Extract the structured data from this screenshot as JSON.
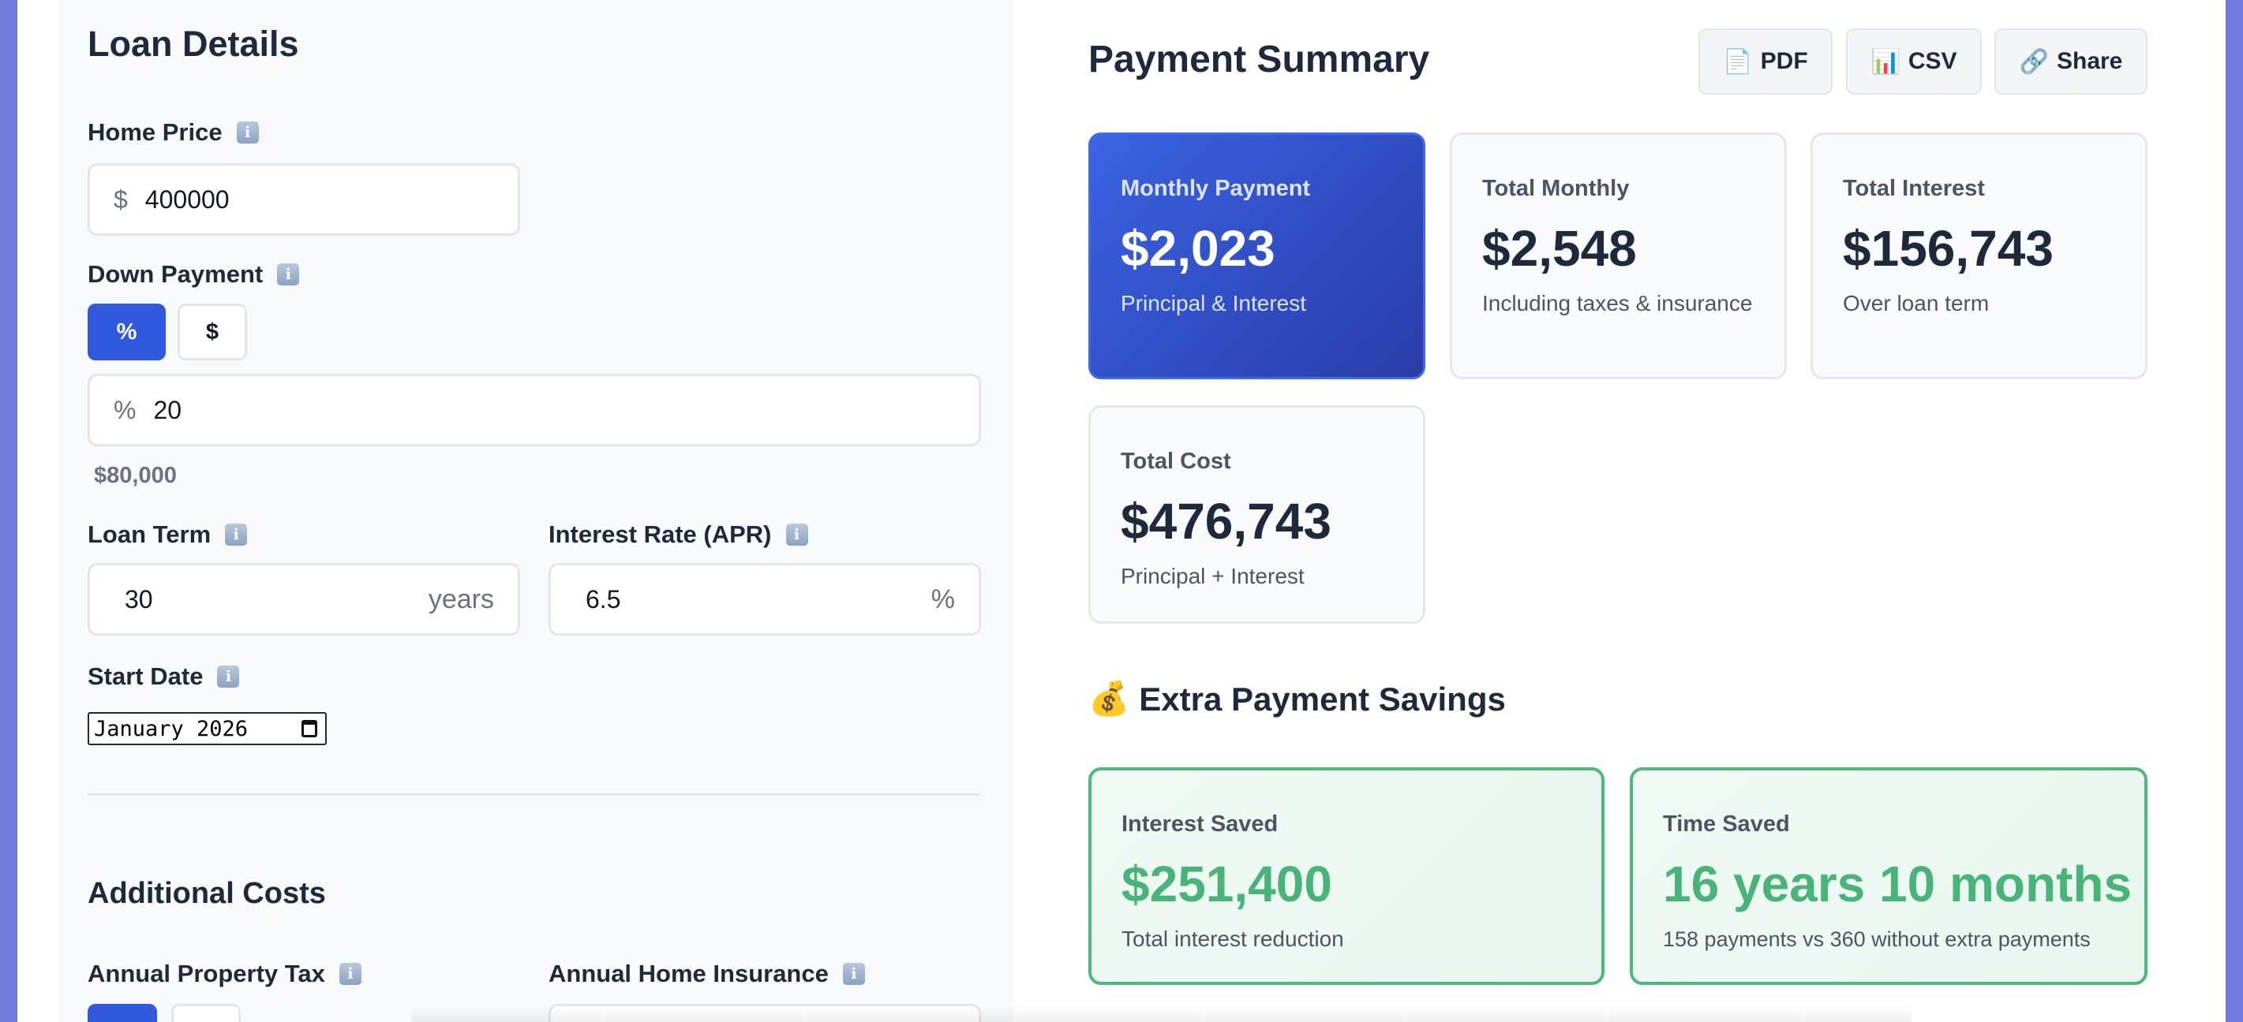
{
  "loan_details": {
    "title": "Loan Details",
    "home_price": {
      "label": "Home Price",
      "prefix": "$",
      "value": "400000"
    },
    "down_payment": {
      "label": "Down Payment",
      "toggle_percent": "%",
      "toggle_dollar": "$",
      "prefix": "%",
      "value": "20",
      "helper": "$80,000"
    },
    "loan_term": {
      "label": "Loan Term",
      "value": "30",
      "suffix": "years"
    },
    "interest_rate": {
      "label": "Interest Rate (APR)",
      "value": "6.5",
      "suffix": "%"
    },
    "start_date": {
      "label": "Start Date",
      "value": "January 2026"
    }
  },
  "additional_costs": {
    "title": "Additional Costs",
    "property_tax_label": "Annual Property Tax",
    "home_insurance_label": "Annual Home Insurance"
  },
  "summary": {
    "title": "Payment Summary",
    "actions": {
      "pdf": {
        "icon": "📄",
        "label": "PDF"
      },
      "csv": {
        "icon": "📊",
        "label": "CSV"
      },
      "share": {
        "icon": "🔗",
        "label": "Share"
      }
    },
    "cards": {
      "monthly_payment": {
        "title": "Monthly Payment",
        "value": "$2,023",
        "sub": "Principal & Interest"
      },
      "total_monthly": {
        "title": "Total Monthly",
        "value": "$2,548",
        "sub": "Including taxes & insurance"
      },
      "total_interest": {
        "title": "Total Interest",
        "value": "$156,743",
        "sub": "Over loan term"
      },
      "total_cost": {
        "title": "Total Cost",
        "value": "$476,743",
        "sub": "Principal + Interest"
      }
    }
  },
  "extra_savings": {
    "icon": "💰",
    "title": "Extra Payment Savings",
    "interest_saved": {
      "title": "Interest Saved",
      "value": "$251,400",
      "sub": "Total interest reduction"
    },
    "time_saved": {
      "title": "Time Saved",
      "value": "16 years 10 months",
      "sub": "158 payments vs 360 without extra payments"
    }
  },
  "colors": {
    "accent": "#3159dd",
    "success": "#49b47a",
    "page_bg": "#7079dc"
  }
}
